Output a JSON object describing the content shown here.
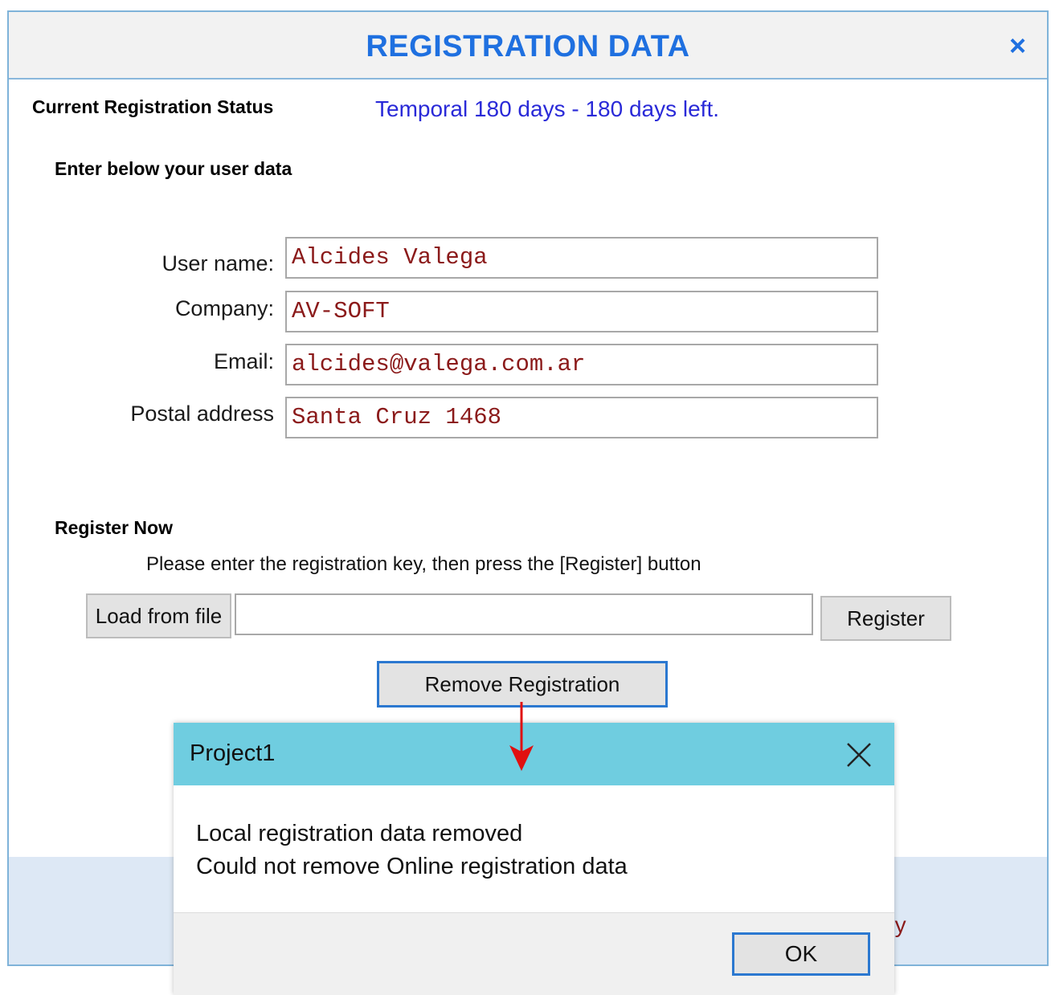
{
  "window": {
    "title": "REGISTRATION DATA",
    "close_glyph": "×"
  },
  "status": {
    "label": "Current Registration Status",
    "value": "Temporal 180 days - 180 days left."
  },
  "user_section": {
    "heading": "Enter below your user data",
    "fields": [
      {
        "label": "User name:",
        "value": "Alcides Valega"
      },
      {
        "label": "Company:",
        "value": "AV-SOFT"
      },
      {
        "label": "Email:",
        "value": "alcides@valega.com.ar"
      },
      {
        "label": "Postal address",
        "value": "Santa Cruz 1468"
      }
    ]
  },
  "register_section": {
    "heading": "Register Now",
    "hint": "Please enter the registration key, then press the [Register] button",
    "load_label": "Load from file",
    "key_value": "",
    "register_label": "Register",
    "remove_label": "Remove Registration"
  },
  "footer": {
    "peek_text": "ey"
  },
  "message_box": {
    "title": "Project1",
    "lines": [
      "Local registration data removed",
      "Could not remove Online registration data"
    ],
    "ok_label": "OK"
  },
  "colors": {
    "title_blue": "#1f70e0",
    "status_blue": "#2a2ad8",
    "field_text": "#8b1a1a",
    "msgbox_titlebar": "#6fcde0",
    "arrow_red": "#e01010"
  }
}
